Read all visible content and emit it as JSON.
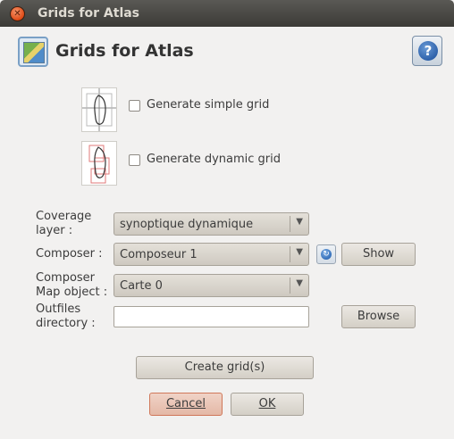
{
  "window": {
    "title": "Grids for Atlas"
  },
  "header": {
    "title": "Grids for Atlas",
    "help_icon_glyph": "?"
  },
  "options": {
    "simple_grid_label": "Generate simple grid",
    "dynamic_grid_label": "Generate dynamic grid",
    "simple_grid_checked": false,
    "dynamic_grid_checked": false
  },
  "form": {
    "coverage_label_line1": "Coverage",
    "coverage_label_line2": "layer :",
    "coverage_value": "synoptique dynamique",
    "composer_label": "Composer :",
    "composer_value": "Composeur 1",
    "show_label": "Show",
    "map_label_line1": "Composer",
    "map_label_line2": "Map object :",
    "map_value": "Carte 0",
    "outfiles_label_line1": "Outfiles",
    "outfiles_label_line2": "directory :",
    "outfiles_value": "",
    "browse_label": "Browse"
  },
  "actions": {
    "create_label": "Create grid(s)",
    "cancel_label": "Cancel",
    "ok_label": "OK"
  }
}
